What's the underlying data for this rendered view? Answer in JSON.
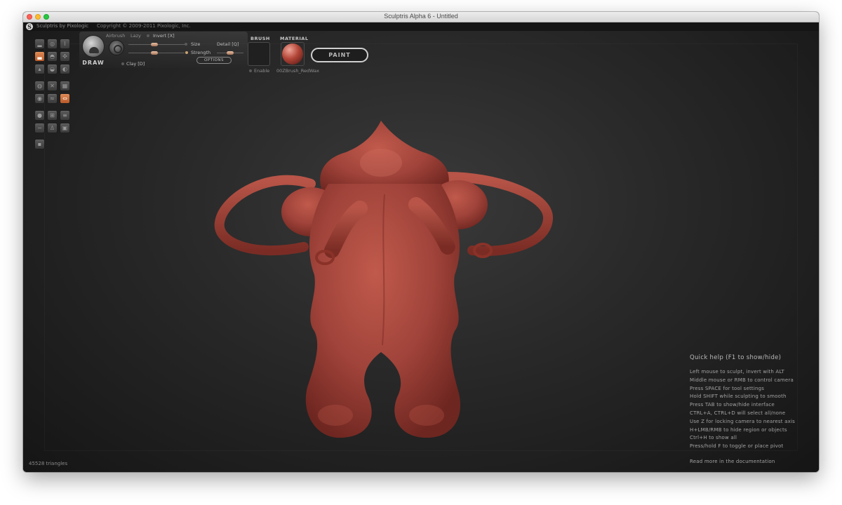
{
  "window": {
    "title": "Sculptris Alpha 6 - Untitled"
  },
  "brand": {
    "logo_letter": "S",
    "name": "Sculptris by Pixologic",
    "copyright": "Copyright © 2009-2011 Pixologic, Inc."
  },
  "tools": {
    "grid_icons": [
      "draw-icon",
      "smooth-icon",
      "crease-icon",
      "flatten-icon",
      "inflate-icon",
      "pinch-icon",
      "grab-icon",
      "scale-icon",
      "rotate-icon",
      "mask-icon",
      "reduce-icon",
      "symmetry-icon",
      "globe-icon",
      "wire-icon",
      "square-icon",
      "plus-icon",
      "minus-icon",
      "box-icon",
      "save-icon"
    ]
  },
  "brush_panel": {
    "tool_label": "DRAW",
    "airbrush_label": "Airbrush",
    "lazy_label": "Lazy",
    "invert_label": "Invert [X]",
    "size_label": "Size",
    "detail_label": "Detail [Q]",
    "strength_label": "Strength",
    "options_label": "OPTIONS",
    "clay_label": "Clay [D]",
    "size_value": 0.5,
    "strength_value": 0.5,
    "detail_value": 0.6
  },
  "brush": {
    "title": "BRUSH",
    "enable_label": "Enable"
  },
  "material": {
    "title": "MATERIAL",
    "name": "00ZBrush_RedWax",
    "color": "#b24638"
  },
  "paint_button": {
    "label": "PAINT"
  },
  "quick_help": {
    "title": "Quick help (F1 to show/hide)",
    "lines": [
      "Left mouse to sculpt, invert with ALT",
      "Middle mouse or RMB to control camera",
      "Press SPACE for tool settings",
      "Hold SHIFT while sculpting to smooth",
      "Press TAB to show/hide interface",
      "CTRL+A, CTRL+D will select all/none",
      "Use Z for locking camera to nearest axis",
      "H+LMB/RMB to hide region or objects",
      "Ctrl+H to show all",
      "Press/hold F to toggle or place pivot"
    ],
    "more": "Read more in the documentation"
  },
  "status": {
    "triangles": "45528 triangles"
  },
  "colors": {
    "model": "#a0433a",
    "accent": "#d97a45",
    "background": "#2a2a2a"
  }
}
